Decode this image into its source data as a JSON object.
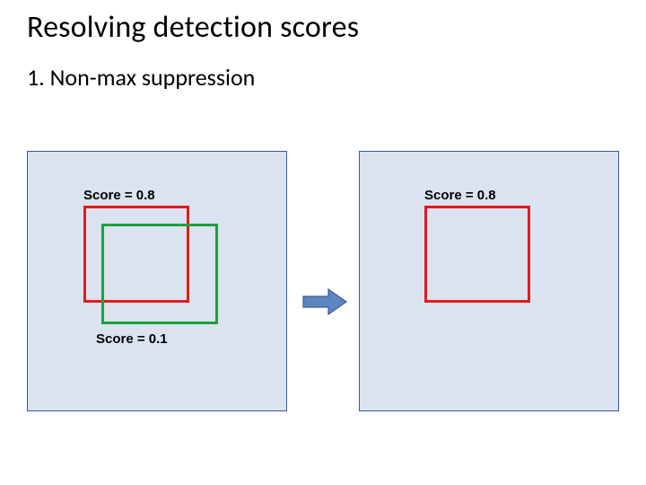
{
  "slide": {
    "title": "Resolving detection scores",
    "subtitle": "1.  Non-max suppression"
  },
  "panels": {
    "left": {
      "top_label": "Score = 0.8",
      "bottom_label": "Score = 0.1",
      "boxes": [
        {
          "name": "high-score-box",
          "color": "#e11b1b",
          "score": 0.8
        },
        {
          "name": "suppressed-box",
          "color": "#18a33a",
          "score": 0.1
        }
      ]
    },
    "right": {
      "top_label": "Score = 0.8",
      "boxes": [
        {
          "name": "surviving-box",
          "color": "#e11b1b",
          "score": 0.8
        }
      ]
    }
  },
  "arrow": {
    "fill": "#5b86c2",
    "stroke": "#3a5a8e"
  }
}
